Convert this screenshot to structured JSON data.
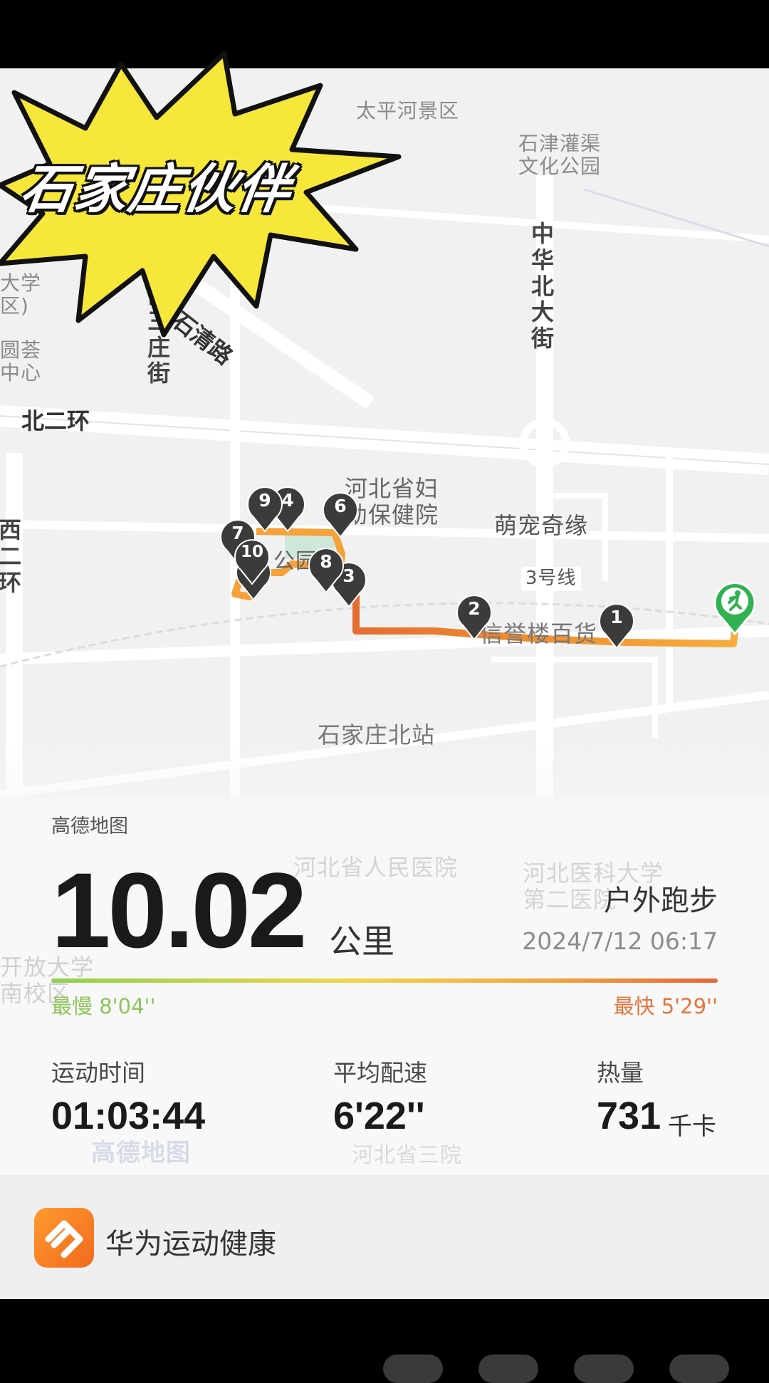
{
  "overlay": {
    "title": "石家庄伙伴"
  },
  "map": {
    "provider": "高德地图",
    "labels": {
      "taiping": "太平河景区",
      "shijin_l1": "石津灌渠",
      "shijin_l2": "文化公园",
      "daxue_l1": "大学",
      "daxue_l2": "区)",
      "yuanhui_l1": "圆荟",
      "yuanhui_l2": "中心",
      "beierhuan": "北二环",
      "shiqinglu": "石清路",
      "xisanzhuang": "西三庄街",
      "zhonghua": "中华北大街",
      "xierhuan": "西二环",
      "fuyou_l1": "河北省妇",
      "fuyou_l2": "幼保健院",
      "mengchong": "萌宠奇缘",
      "line3": "3号线",
      "xinyu": "信誉楼百货",
      "park": "公园",
      "beizhan": "石家庄北站",
      "renmin": "河北省人民医院",
      "yike_l1": "河北医科大学",
      "yike_l2": "第二医院",
      "kaifang_l1": "开放大学",
      "kaifang_l2": "南校区",
      "sanyuan": "河北省三院",
      "watermark": "高德地图"
    },
    "km_markers": [
      "1",
      "2",
      "3",
      "4",
      "5",
      "6",
      "7",
      "8",
      "9",
      "10"
    ]
  },
  "workout": {
    "distance": "10.02",
    "distance_unit": "公里",
    "type": "户外跑步",
    "datetime": "2024/7/12 06:17",
    "slowest": "最慢 8'04''",
    "fastest": "最快 5'29''",
    "pace_colors": {
      "slow": "#8fd14f",
      "mid": "#f2d64b",
      "fast": "#e4673a"
    }
  },
  "stats": [
    {
      "label": "运动时间",
      "value": "01:03:44",
      "unit": ""
    },
    {
      "label": "平均配速",
      "value": "6'22''",
      "unit": ""
    },
    {
      "label": "热量",
      "value": "731",
      "unit": "千卡"
    }
  ],
  "footer": {
    "app_name": "华为运动健康",
    "app_icon": "huawei-health-icon"
  }
}
